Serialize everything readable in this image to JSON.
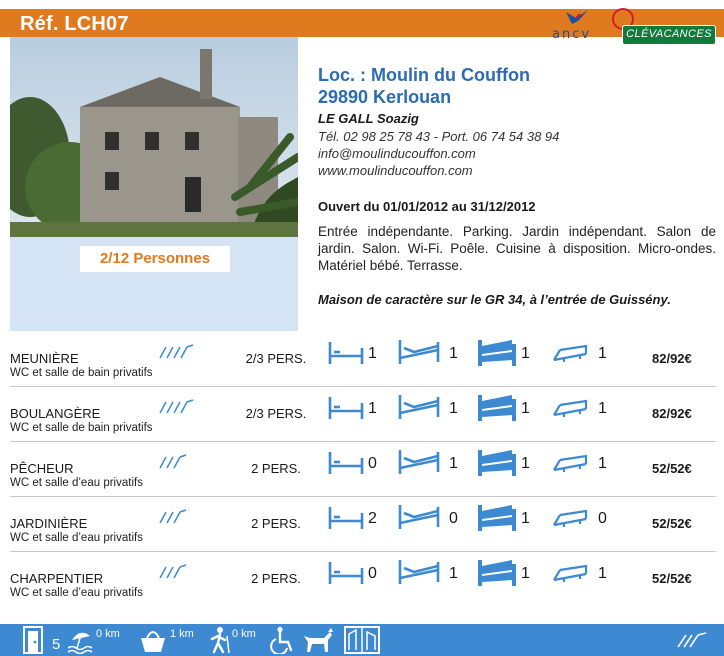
{
  "header": {
    "ref": "Réf. LCH07",
    "ancv_logo": "ancv",
    "clevacances_logo": "CLÉVACANCES",
    "header_color": "#e07a1f"
  },
  "listing": {
    "persons": "2/12 Personnes",
    "title_line1": "Loc. : Moulin du Couffon",
    "title_line2": "29890 Kerlouan",
    "owner": "LE GALL Soazig",
    "phone": "Tél. 02 98 25 78 43 - Port. 06 74 54 38 94",
    "email": "info@moulinducouffon.com",
    "website": "www.moulinducouffon.com",
    "opening": "Ouvert du 01/01/2012 au 31/12/2012",
    "description": "Entrée indépendante. Parking. Jardin indépendant. Salon de jardin. Salon. Wi-Fi. Poêle. Cuisine à disposition. Micro-ondes. Matériel bébé. Terrasse.",
    "tagline": "Maison de caractère sur le GR 34, à l’entrée de Guissény."
  },
  "rooms": [
    {
      "name": "MEUNIÈRE",
      "bath": "WC et salle de bain privatifs",
      "rating": 4,
      "persons": "2/3 PERS.",
      "beds": [
        "1",
        "1",
        "1",
        "1"
      ],
      "price": "82/92€"
    },
    {
      "name": "BOULANGÈRE",
      "bath": "WC et salle de bain privatifs",
      "rating": 4,
      "persons": "2/3 PERS.",
      "beds": [
        "1",
        "1",
        "1",
        "1"
      ],
      "price": "82/92€"
    },
    {
      "name": "PÊCHEUR",
      "bath": "WC et salle d’eau privatifs",
      "rating": 3,
      "persons": "2 PERS.",
      "beds": [
        "0",
        "1",
        "1",
        "1"
      ],
      "price": "52/52€"
    },
    {
      "name": "JARDINIÈRE",
      "bath": "WC et salle d’eau privatifs",
      "rating": 3,
      "persons": "2 PERS.",
      "beds": [
        "2",
        "0",
        "1",
        "0"
      ],
      "price": "52/52€"
    },
    {
      "name": "CHARPENTIER",
      "bath": "WC et salle d’eau privatifs",
      "rating": 3,
      "persons": "2 PERS.",
      "beds": [
        "0",
        "1",
        "1",
        "1"
      ],
      "price": "52/52€"
    }
  ],
  "bed_icons": [
    "single-bed-icon",
    "double-bed-icon",
    "bunk-bed-icon",
    "extra-bed-icon"
  ],
  "footer": {
    "rooms_count": "5",
    "beach_distance": "0 km",
    "shop_distance": "1 km",
    "hiking_distance": "0 km",
    "icons": [
      "door-icon",
      "beach-icon",
      "shopping-icon",
      "hiking-icon",
      "accessibility-icon",
      "dog-icon",
      "tourism-label-icon",
      "rating-icon"
    ],
    "footer_color": "#3d8ad2"
  },
  "colors": {
    "accent_blue": "#2b6cb3",
    "light_blue": "#d4e4f5",
    "orange": "#e07a1f",
    "icon_blue": "#3d8ad2"
  }
}
